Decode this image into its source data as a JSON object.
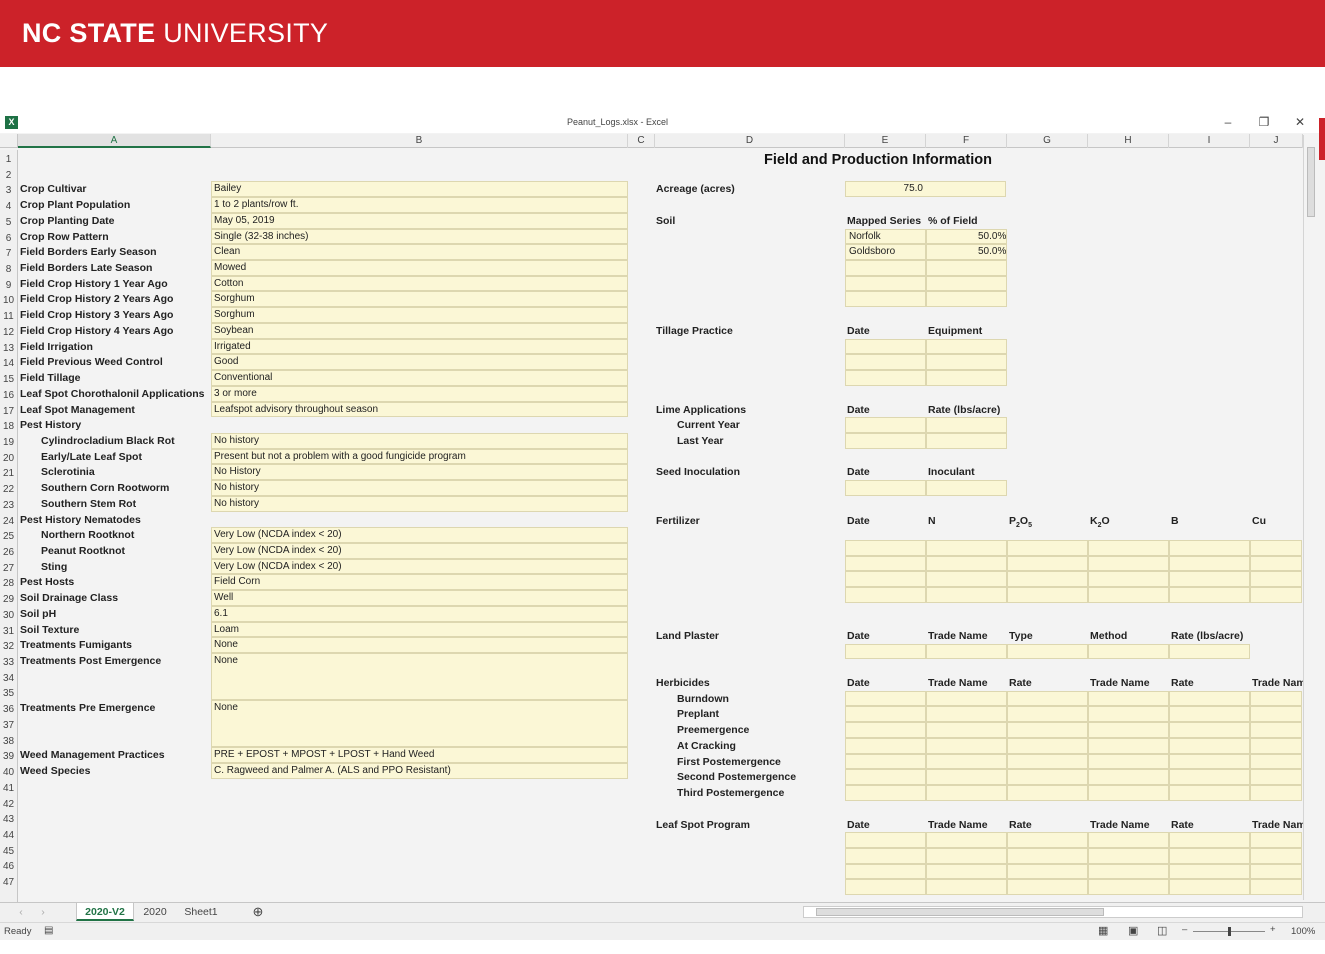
{
  "banner": {
    "brand_bold": "NC STATE",
    "brand_rest": " UNIVERSITY"
  },
  "window": {
    "title": "Peanut_Logs.xlsx - Excel",
    "min_icon": "minimize-icon",
    "max_icon": "restore-icon",
    "close_icon": "close-icon"
  },
  "columns": [
    "A",
    "B",
    "C",
    "D",
    "E",
    "F",
    "G",
    "H",
    "I",
    "J"
  ],
  "rows": [
    "1",
    "2",
    "3",
    "4",
    "5",
    "6",
    "7",
    "8",
    "9",
    "10",
    "11",
    "12",
    "13",
    "14",
    "15",
    "16",
    "17",
    "18",
    "19",
    "20",
    "21",
    "22",
    "23",
    "24",
    "25",
    "26",
    "27",
    "28",
    "29",
    "30",
    "31",
    "32",
    "33",
    "34",
    "35",
    "36",
    "37",
    "38",
    "39",
    "40",
    "41",
    "42",
    "43",
    "44",
    "45",
    "46",
    "47"
  ],
  "sheet_title": "Field and Production Information",
  "left": [
    {
      "label": "Crop Cultivar",
      "value": "Bailey"
    },
    {
      "label": "Crop Plant Population",
      "value": "1 to 2 plants/row ft."
    },
    {
      "label": "Crop Planting Date",
      "value": "May 05, 2019"
    },
    {
      "label": "Crop Row Pattern",
      "value": "Single (32-38 inches)"
    },
    {
      "label": "Field Borders Early Season",
      "value": "Clean"
    },
    {
      "label": "Field Borders Late Season",
      "value": "Mowed"
    },
    {
      "label": "Field Crop History 1 Year Ago",
      "value": "Cotton"
    },
    {
      "label": "Field Crop History 2 Years Ago",
      "value": "Sorghum"
    },
    {
      "label": "Field Crop History 3 Years Ago",
      "value": "Sorghum"
    },
    {
      "label": "Field Crop History 4 Years Ago",
      "value": "Soybean"
    },
    {
      "label": "Field Irrigation",
      "value": "Irrigated"
    },
    {
      "label": "Field Previous Weed Control",
      "value": "Good"
    },
    {
      "label": "Field Tillage",
      "value": "Conventional"
    },
    {
      "label": "Leaf Spot Chorothalonil Applications",
      "value": "3 or more"
    },
    {
      "label": "Leaf Spot Management",
      "value": "Leafspot advisory throughout season"
    },
    {
      "label": "Pest History",
      "value": ""
    },
    {
      "label": "Cylindrocladium Black Rot",
      "value": "No history",
      "indent": true
    },
    {
      "label": "Early/Late Leaf Spot",
      "value": "Present but not a problem with a good fungicide program",
      "indent": true
    },
    {
      "label": "Sclerotinia",
      "value": "No History",
      "indent": true
    },
    {
      "label": "Southern Corn Rootworm",
      "value": "No history",
      "indent": true
    },
    {
      "label": "Southern Stem Rot",
      "value": "No history",
      "indent": true
    },
    {
      "label": "Pest History Nematodes",
      "value": ""
    },
    {
      "label": "Northern Rootknot",
      "value": "Very Low (NCDA index <  20)",
      "indent": true
    },
    {
      "label": "Peanut Rootknot",
      "value": "Very Low (NCDA index <  20)",
      "indent": true
    },
    {
      "label": "Sting",
      "value": "Very Low (NCDA index <  20)",
      "indent": true
    },
    {
      "label": "Pest Hosts",
      "value": "Field Corn"
    },
    {
      "label": "Soil Drainage Class",
      "value": "Well"
    },
    {
      "label": "Soil pH",
      "value": "6.1"
    },
    {
      "label": "Soil Texture",
      "value": "Loam"
    },
    {
      "label": "Treatments Fumigants",
      "value": "None"
    },
    {
      "label": "Treatments Post Emergence",
      "value": "None"
    },
    {
      "label": "Treatments Pre Emergence",
      "value": "None"
    },
    {
      "label": "Weed Management Practices",
      "value": "PRE + EPOST + MPOST + LPOST + Hand Weed"
    },
    {
      "label": "Weed Species",
      "value": "C. Ragweed and Palmer A. (ALS and PPO Resistant)"
    }
  ],
  "right": {
    "acreage_label": "Acreage (acres)",
    "acreage_value": "75.0",
    "soil_label": "Soil",
    "soil_hdr1": "Mapped Series",
    "soil_hdr2": "% of Field",
    "soil_rows": [
      {
        "series": "Norfolk",
        "pct": "50.0%"
      },
      {
        "series": "Goldsboro",
        "pct": "50.0%"
      }
    ],
    "tillage_label": "Tillage Practice",
    "tillage_hdr1": "Date",
    "tillage_hdr2": "Equipment",
    "lime_label": "Lime Applications",
    "lime_hdr1": "Date",
    "lime_hdr2": "Rate (lbs/acre)",
    "lime_current": "Current Year",
    "lime_last": "Last Year",
    "seed_label": "Seed Inoculation",
    "seed_hdr1": "Date",
    "seed_hdr2": "Inoculant",
    "fert_label": "Fertilizer",
    "fert_hdrs": [
      "Date",
      "N",
      "P",
      "2",
      "O",
      "5",
      "K",
      "2",
      "O",
      "B",
      "Cu"
    ],
    "plaster_label": "Land Plaster",
    "plaster_hdrs": [
      "Date",
      "Trade Name",
      "Type",
      "Method",
      "Rate (lbs/acre)"
    ],
    "herb_label": "Herbicides",
    "herb_hdrs": [
      "Date",
      "Trade Name",
      "Rate",
      "Trade Name",
      "Rate",
      "Trade Nam"
    ],
    "herb_rows": [
      "Burndown",
      "Preplant",
      "Preemergence",
      "At Cracking",
      "First Postemergence",
      "Second Postemergence",
      "Third Postemergence"
    ],
    "leaf_label": "Leaf Spot Program",
    "leaf_hdrs": [
      "Date",
      "Trade Name",
      "Rate",
      "Trade Name",
      "Rate",
      "Trade Nam"
    ]
  },
  "tabs": [
    "2020-V2",
    "2020",
    "Sheet1"
  ],
  "status": {
    "ready": "Ready",
    "zoom": "100%"
  }
}
